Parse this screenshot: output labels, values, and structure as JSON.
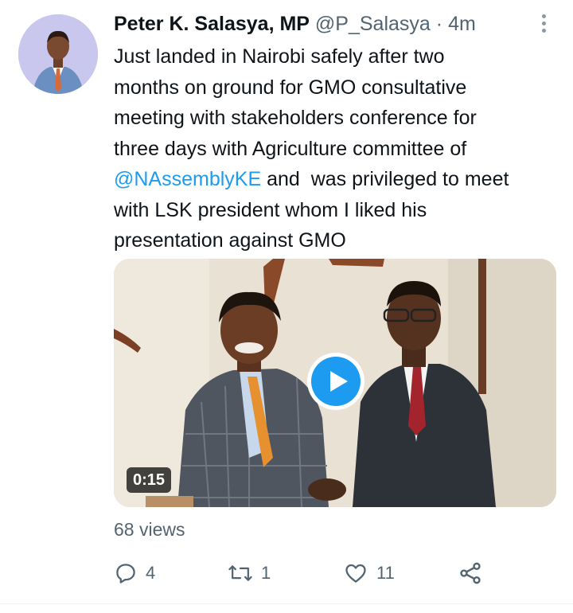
{
  "tweet": {
    "author_name": "Peter K. Salasya, MP",
    "handle": "@P_Salasya",
    "separator": "·",
    "time": "4m",
    "text_lines": [
      "Just landed in Nairobi safely after two",
      "months on ground for GMO consultative",
      "meeting with stakeholders conference for",
      "three days with Agriculture committee of"
    ],
    "mention": "@NAssemblyKE",
    "after_mention": " and  was privileged to meet",
    "text_lines_end": [
      "with LSK president whom I liked his",
      "presentation against GMO"
    ],
    "video": {
      "duration": "0:15"
    },
    "views": "68 views",
    "actions": {
      "replies": "4",
      "retweets": "1",
      "likes": "11"
    }
  },
  "colors": {
    "accent": "#1d9bf0",
    "secondary_text": "#536471",
    "primary_text": "#0f1419"
  },
  "icons": {
    "more": "more-vertical-icon",
    "reply": "reply-icon",
    "retweet": "retweet-icon",
    "like": "heart-icon",
    "share": "share-icon",
    "play": "play-icon"
  }
}
